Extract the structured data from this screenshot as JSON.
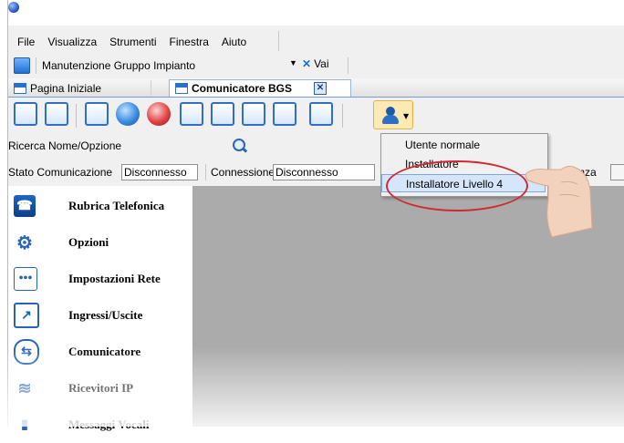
{
  "menubar": [
    "File",
    "Visualizza",
    "Strumenti",
    "Finestra",
    "Aiuto"
  ],
  "address": {
    "value": "Manutenzione Gruppo Impianto",
    "go_label": "Vai"
  },
  "tabs": [
    {
      "label": "Pagina Iniziale"
    },
    {
      "label": "Comunicatore BGS"
    }
  ],
  "search": {
    "label": "Ricerca Nome/Opzione"
  },
  "status": {
    "stato_label": "Stato Comunicazione",
    "stato_value": "Disconnesso",
    "conn_label": "Connessione",
    "conn_value": "Disconnesso",
    "trailing_label": "ienza"
  },
  "user_menu": {
    "items": [
      "Utente normale",
      "Installatore",
      "Installatore Livello 4"
    ],
    "selected_index": 2
  },
  "sidebar": {
    "items": [
      {
        "label": "Rubrica Telefonica",
        "icon": "phone-book-icon"
      },
      {
        "label": "Opzioni",
        "icon": "gears-icon"
      },
      {
        "label": "Impostazioni Rete",
        "icon": "network-dots-icon"
      },
      {
        "label": "Ingressi/Uscite",
        "icon": "io-arrow-icon"
      },
      {
        "label": "Comunicatore",
        "icon": "communicator-arrows-icon"
      },
      {
        "label": "Ricevitori IP",
        "icon": "wifi-icon"
      },
      {
        "label": "Messaggi Vocali",
        "icon": "microphone-icon"
      }
    ]
  },
  "colors": {
    "accent_blue": "#2f6fc6",
    "highlight_oval": "#cf2a32",
    "menu_selected": "#d5e5fa",
    "content_gray": "#ababab"
  }
}
